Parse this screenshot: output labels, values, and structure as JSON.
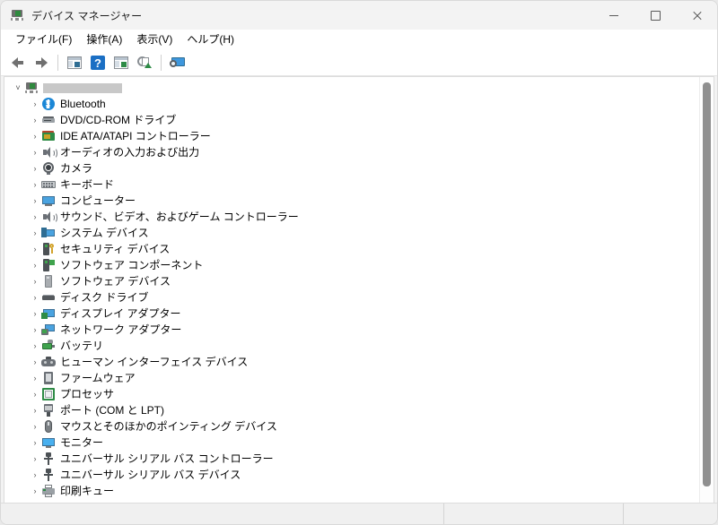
{
  "window": {
    "title": "デバイス マネージャー",
    "title_icon": "device-manager-icon",
    "controls": {
      "minimize": "minimize-button",
      "maximize": "maximize-button",
      "close": "close-button"
    }
  },
  "menubar": {
    "items": [
      {
        "label": "ファイル(F)",
        "name": "menu-file"
      },
      {
        "label": "操作(A)",
        "name": "menu-action"
      },
      {
        "label": "表示(V)",
        "name": "menu-view"
      },
      {
        "label": "ヘルプ(H)",
        "name": "menu-help"
      }
    ]
  },
  "toolbar": {
    "buttons": [
      {
        "name": "back-button",
        "icon": "arrow-left-icon"
      },
      {
        "name": "forward-button",
        "icon": "arrow-right-icon"
      },
      {
        "name": "separator-1",
        "icon": "separator"
      },
      {
        "name": "properties-button",
        "icon": "properties-panel-icon"
      },
      {
        "name": "help-button",
        "icon": "help-question-icon"
      },
      {
        "name": "show-hidden-devices-button",
        "icon": "panel-play-icon"
      },
      {
        "name": "update-driver-button",
        "icon": "update-driver-icon"
      },
      {
        "name": "separator-2",
        "icon": "separator"
      },
      {
        "name": "scan-hardware-changes-button",
        "icon": "scan-monitor-icon"
      }
    ]
  },
  "tree": {
    "root": {
      "label": "",
      "redacted": true,
      "expanded": true,
      "chevron": "chevron-down-icon",
      "icon": "computer-root-icon"
    },
    "items": [
      {
        "label": "Bluetooth",
        "icon": "bluetooth-icon",
        "name": "tree-item-bluetooth"
      },
      {
        "label": "DVD/CD-ROM ドライブ",
        "icon": "dvd-drive-icon",
        "name": "tree-item-dvd-cdrom-drive"
      },
      {
        "label": "IDE ATA/ATAPI コントローラー",
        "icon": "ide-controller-icon",
        "name": "tree-item-ide-ata-atapi-controller"
      },
      {
        "label": "オーディオの入力および出力",
        "icon": "audio-speaker-icon",
        "name": "tree-item-audio-inputs-outputs"
      },
      {
        "label": "カメラ",
        "icon": "camera-icon",
        "name": "tree-item-cameras"
      },
      {
        "label": "キーボード",
        "icon": "keyboard-icon",
        "name": "tree-item-keyboards"
      },
      {
        "label": "コンピューター",
        "icon": "computer-icon",
        "name": "tree-item-computer"
      },
      {
        "label": "サウンド、ビデオ、およびゲーム コントローラー",
        "icon": "audio-speaker-icon",
        "name": "tree-item-sound-video-game-controllers"
      },
      {
        "label": "システム デバイス",
        "icon": "system-devices-icon",
        "name": "tree-item-system-devices"
      },
      {
        "label": "セキュリティ デバイス",
        "icon": "security-device-icon",
        "name": "tree-item-security-devices"
      },
      {
        "label": "ソフトウェア コンポーネント",
        "icon": "software-component-icon",
        "name": "tree-item-software-components"
      },
      {
        "label": "ソフトウェア デバイス",
        "icon": "software-device-icon",
        "name": "tree-item-software-devices"
      },
      {
        "label": "ディスク ドライブ",
        "icon": "disk-drive-icon",
        "name": "tree-item-disk-drives"
      },
      {
        "label": "ディスプレイ アダプター",
        "icon": "display-adapter-icon",
        "name": "tree-item-display-adapters"
      },
      {
        "label": "ネットワーク アダプター",
        "icon": "network-adapter-icon",
        "name": "tree-item-network-adapters"
      },
      {
        "label": "バッテリ",
        "icon": "battery-icon",
        "name": "tree-item-batteries"
      },
      {
        "label": "ヒューマン インターフェイス デバイス",
        "icon": "hid-gamepad-icon",
        "name": "tree-item-human-interface-devices"
      },
      {
        "label": "ファームウェア",
        "icon": "firmware-chip-icon",
        "name": "tree-item-firmware"
      },
      {
        "label": "プロセッサ",
        "icon": "processor-icon",
        "name": "tree-item-processors"
      },
      {
        "label": "ポート (COM と LPT)",
        "icon": "port-connector-icon",
        "name": "tree-item-ports-com-lpt"
      },
      {
        "label": "マウスとそのほかのポインティング デバイス",
        "icon": "mouse-icon",
        "name": "tree-item-mice-other-pointing-devices"
      },
      {
        "label": "モニター",
        "icon": "monitor-icon",
        "name": "tree-item-monitors"
      },
      {
        "label": "ユニバーサル シリアル バス コントローラー",
        "icon": "usb-icon",
        "name": "tree-item-usb-controllers"
      },
      {
        "label": "ユニバーサル シリアル バス デバイス",
        "icon": "usb-icon",
        "name": "tree-item-usb-devices"
      },
      {
        "label": "印刷キュー",
        "icon": "printer-icon",
        "name": "tree-item-print-queues"
      }
    ],
    "chevron_collapsed": "›"
  },
  "scrollbar": {
    "name": "vertical-scrollbar",
    "thumb": "scrollbar-thumb"
  },
  "statusbar": {
    "pane1": "",
    "pane2": "",
    "pane3": ""
  },
  "colors": {
    "window_bg": "#f3f3f3",
    "content_bg": "#ffffff",
    "accent_blue": "#1b6fc4",
    "redaction": "#c8c8c8",
    "scrollbar_thumb": "#8f8f8f"
  }
}
